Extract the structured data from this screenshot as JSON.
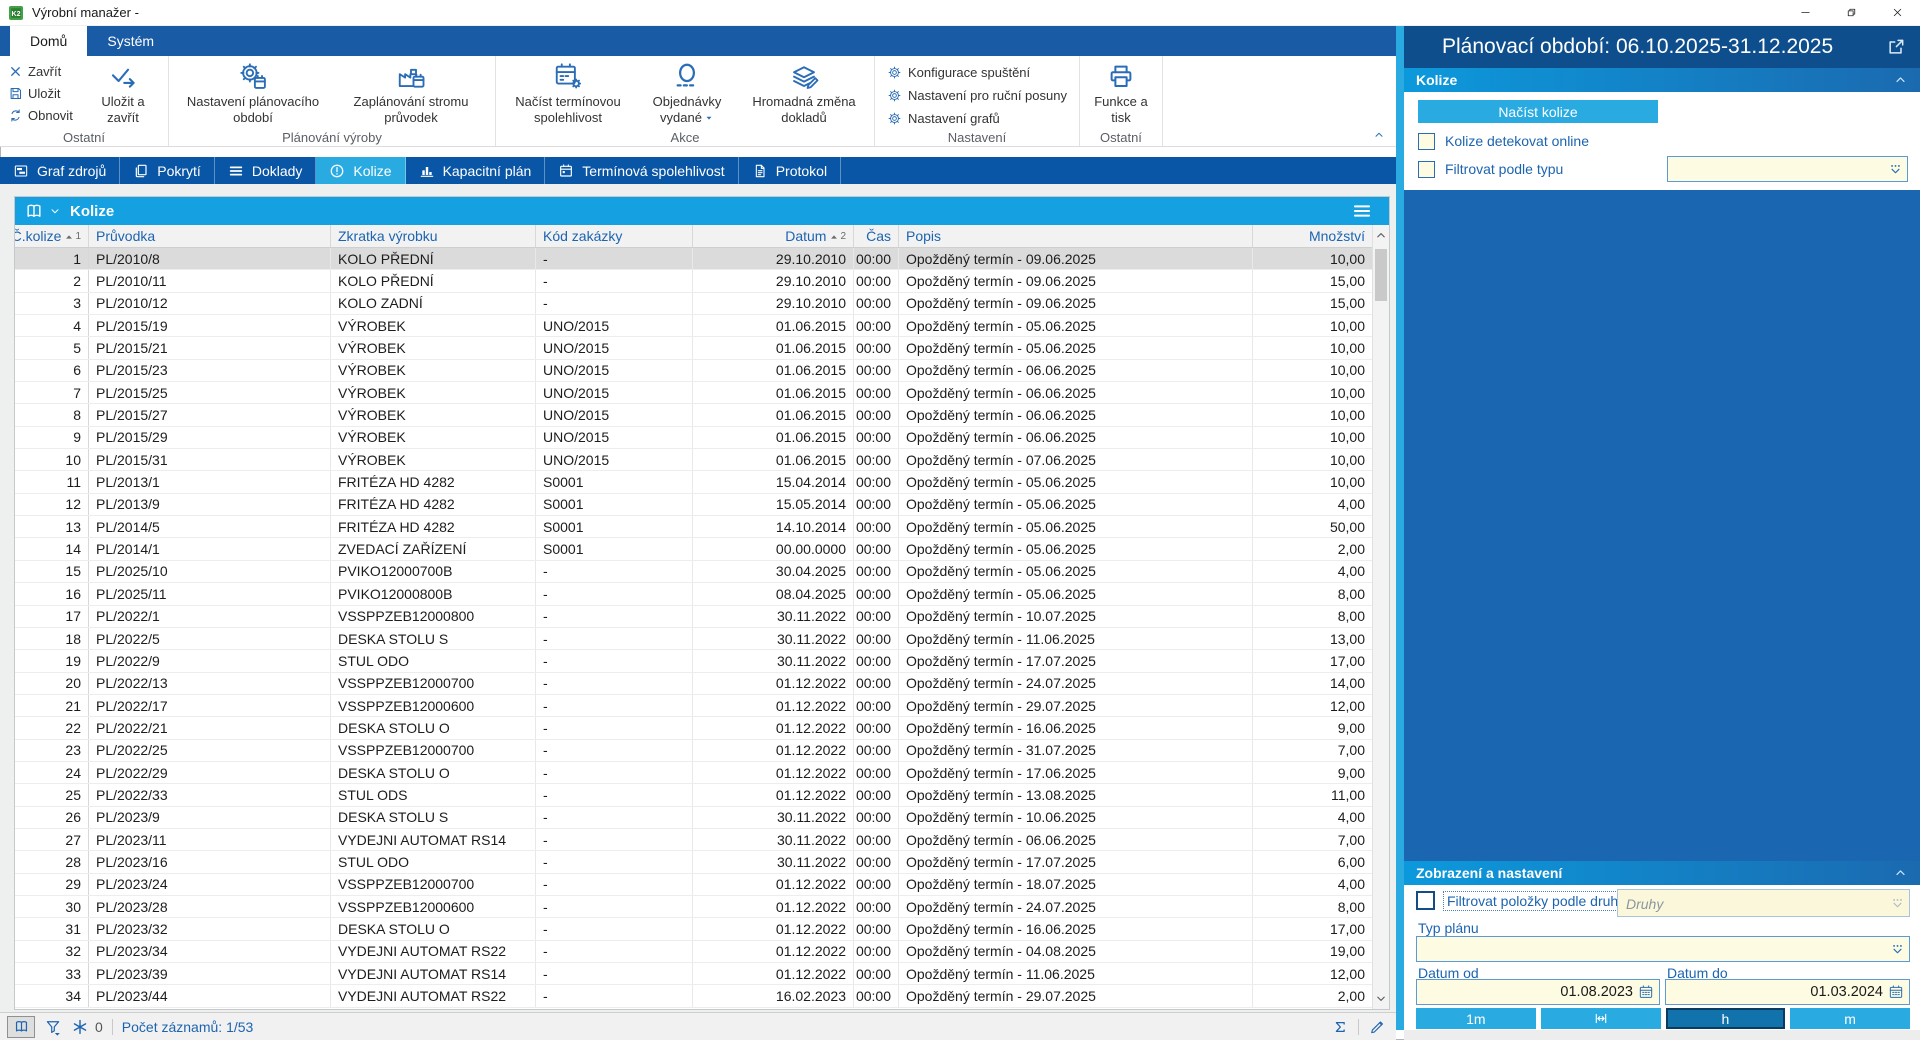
{
  "window": {
    "title": "Výrobní manažer -"
  },
  "ribbon": {
    "tabs": [
      {
        "label": "Domů",
        "active": true
      },
      {
        "label": "Systém",
        "active": false
      }
    ],
    "groups": [
      {
        "label": "Ostatní",
        "small_buttons": [
          {
            "icon": "close-x-icon",
            "label": "Zavřít"
          },
          {
            "icon": "save-icon",
            "label": "Uložit"
          },
          {
            "icon": "refresh-icon",
            "label": "Obnovit"
          }
        ],
        "big_buttons": [
          {
            "icon": "save-close-icon",
            "label": "Uložit a zavřít"
          }
        ]
      },
      {
        "label": "Plánování výroby",
        "big_buttons": [
          {
            "icon": "gear-calendar-icon",
            "label": "Nastavení plánovacího období"
          },
          {
            "icon": "factory-calendar-icon",
            "label": "Zaplánování stromu průvodek"
          }
        ]
      },
      {
        "label": "Akce",
        "big_buttons": [
          {
            "icon": "calendar-gear-icon",
            "label": "Načíst termínovou spolehlivost"
          },
          {
            "icon": "orders-icon",
            "label": "Objednávky vydané",
            "dropdown": true
          },
          {
            "icon": "documents-edit-icon",
            "label": "Hromadná změna dokladů"
          }
        ]
      },
      {
        "label": "Nastavení",
        "menu_items": [
          {
            "icon": "gear-icon",
            "label": "Konfigurace spuštění"
          },
          {
            "icon": "gear-icon",
            "label": "Nastavení pro ruční posuny"
          },
          {
            "icon": "gear-icon",
            "label": "Nastavení grafů"
          }
        ]
      },
      {
        "label": "Ostatní",
        "big_buttons": [
          {
            "icon": "printer-icon",
            "label": "Funkce a tisk"
          }
        ]
      }
    ]
  },
  "view_tabs": [
    {
      "label": "Graf zdrojů",
      "icon": "graf-zdroju-icon",
      "active": false
    },
    {
      "label": "Pokrytí",
      "icon": "pokryti-icon",
      "active": false
    },
    {
      "label": "Doklady",
      "icon": "doklady-icon",
      "active": false
    },
    {
      "label": "Kolize",
      "icon": "kolize-icon",
      "active": true
    },
    {
      "label": "Kapacitní plán",
      "icon": "kapacitni-plan-icon",
      "active": false
    },
    {
      "label": "Termínová spolehlivost",
      "icon": "terminova-icon",
      "active": false
    },
    {
      "label": "Protokol",
      "icon": "protokol-icon",
      "active": false
    }
  ],
  "grid": {
    "title": "Kolize",
    "columns": [
      {
        "label": "Č.kolize",
        "align": "right",
        "sort": "1"
      },
      {
        "label": "Průvodka",
        "align": "left"
      },
      {
        "label": "Zkratka výrobku",
        "align": "left"
      },
      {
        "label": "Kód zakázky",
        "align": "left"
      },
      {
        "label": "Datum",
        "align": "right",
        "sort": "2"
      },
      {
        "label": "Čas",
        "align": "right"
      },
      {
        "label": "Popis",
        "align": "left"
      },
      {
        "label": "Množství",
        "align": "right"
      }
    ],
    "selected_row_index": 0,
    "rows": [
      [
        "1",
        "PL/2010/8",
        "KOLO PŘEDNÍ",
        "-",
        "29.10.2010",
        "00:00",
        "Opožděný termín - 09.06.2025",
        "10,00"
      ],
      [
        "2",
        "PL/2010/11",
        "KOLO PŘEDNÍ",
        "-",
        "29.10.2010",
        "00:00",
        "Opožděný termín - 09.06.2025",
        "15,00"
      ],
      [
        "3",
        "PL/2010/12",
        "KOLO ZADNÍ",
        "-",
        "29.10.2010",
        "00:00",
        "Opožděný termín - 09.06.2025",
        "15,00"
      ],
      [
        "4",
        "PL/2015/19",
        "VÝROBEK",
        "UNO/2015",
        "01.06.2015",
        "00:00",
        "Opožděný termín - 05.06.2025",
        "10,00"
      ],
      [
        "5",
        "PL/2015/21",
        "VÝROBEK",
        "UNO/2015",
        "01.06.2015",
        "00:00",
        "Opožděný termín - 05.06.2025",
        "10,00"
      ],
      [
        "6",
        "PL/2015/23",
        "VÝROBEK",
        "UNO/2015",
        "01.06.2015",
        "00:00",
        "Opožděný termín - 06.06.2025",
        "10,00"
      ],
      [
        "7",
        "PL/2015/25",
        "VÝROBEK",
        "UNO/2015",
        "01.06.2015",
        "00:00",
        "Opožděný termín - 06.06.2025",
        "10,00"
      ],
      [
        "8",
        "PL/2015/27",
        "VÝROBEK",
        "UNO/2015",
        "01.06.2015",
        "00:00",
        "Opožděný termín - 06.06.2025",
        "10,00"
      ],
      [
        "9",
        "PL/2015/29",
        "VÝROBEK",
        "UNO/2015",
        "01.06.2015",
        "00:00",
        "Opožděný termín - 06.06.2025",
        "10,00"
      ],
      [
        "10",
        "PL/2015/31",
        "VÝROBEK",
        "UNO/2015",
        "01.06.2015",
        "00:00",
        "Opožděný termín - 07.06.2025",
        "10,00"
      ],
      [
        "11",
        "PL/2013/1",
        "FRITÉZA HD 4282",
        "S0001",
        "15.04.2014",
        "00:00",
        "Opožděný termín - 05.06.2025",
        "10,00"
      ],
      [
        "12",
        "PL/2013/9",
        "FRITÉZA HD 4282",
        "S0001",
        "15.05.2014",
        "00:00",
        "Opožděný termín - 05.06.2025",
        "4,00"
      ],
      [
        "13",
        "PL/2014/5",
        "FRITÉZA HD 4282",
        "S0001",
        "14.10.2014",
        "00:00",
        "Opožděný termín - 05.06.2025",
        "50,00"
      ],
      [
        "14",
        "PL/2014/1",
        "ZVEDACÍ ZAŘÍZENÍ",
        "S0001",
        "00.00.0000",
        "00:00",
        "Opožděný termín - 05.06.2025",
        "2,00"
      ],
      [
        "15",
        "PL/2025/10",
        "PVIKO12000700B",
        "-",
        "30.04.2025",
        "00:00",
        "Opožděný termín - 05.06.2025",
        "4,00"
      ],
      [
        "16",
        "PL/2025/11",
        "PVIKO12000800B",
        "-",
        "08.04.2025",
        "00:00",
        "Opožděný termín - 05.06.2025",
        "8,00"
      ],
      [
        "17",
        "PL/2022/1",
        "VSSPPZEB12000800",
        "-",
        "30.11.2022",
        "00:00",
        "Opožděný termín - 10.07.2025",
        "8,00"
      ],
      [
        "18",
        "PL/2022/5",
        "DESKA STOLU S",
        "-",
        "30.11.2022",
        "00:00",
        "Opožděný termín - 11.06.2025",
        "13,00"
      ],
      [
        "19",
        "PL/2022/9",
        "STUL ODO",
        "-",
        "30.11.2022",
        "00:00",
        "Opožděný termín - 17.07.2025",
        "17,00"
      ],
      [
        "20",
        "PL/2022/13",
        "VSSPPZEB12000700",
        "-",
        "01.12.2022",
        "00:00",
        "Opožděný termín - 24.07.2025",
        "14,00"
      ],
      [
        "21",
        "PL/2022/17",
        "VSSPPZEB12000600",
        "-",
        "01.12.2022",
        "00:00",
        "Opožděný termín - 29.07.2025",
        "12,00"
      ],
      [
        "22",
        "PL/2022/21",
        "DESKA STOLU O",
        "-",
        "01.12.2022",
        "00:00",
        "Opožděný termín - 16.06.2025",
        "9,00"
      ],
      [
        "23",
        "PL/2022/25",
        "VSSPPZEB12000700",
        "-",
        "01.12.2022",
        "00:00",
        "Opožděný termín - 31.07.2025",
        "7,00"
      ],
      [
        "24",
        "PL/2022/29",
        "DESKA STOLU O",
        "-",
        "01.12.2022",
        "00:00",
        "Opožděný termín - 17.06.2025",
        "9,00"
      ],
      [
        "25",
        "PL/2022/33",
        "STUL ODS",
        "-",
        "01.12.2022",
        "00:00",
        "Opožděný termín - 13.08.2025",
        "11,00"
      ],
      [
        "26",
        "PL/2023/9",
        "DESKA STOLU S",
        "-",
        "30.11.2022",
        "00:00",
        "Opožděný termín - 10.06.2025",
        "4,00"
      ],
      [
        "27",
        "PL/2023/11",
        "VYDEJNI AUTOMAT RS14",
        "-",
        "30.11.2022",
        "00:00",
        "Opožděný termín - 06.06.2025",
        "7,00"
      ],
      [
        "28",
        "PL/2023/16",
        "STUL ODO",
        "-",
        "30.11.2022",
        "00:00",
        "Opožděný termín - 17.07.2025",
        "6,00"
      ],
      [
        "29",
        "PL/2023/24",
        "VSSPPZEB12000700",
        "-",
        "01.12.2022",
        "00:00",
        "Opožděný termín - 18.07.2025",
        "4,00"
      ],
      [
        "30",
        "PL/2023/28",
        "VSSPPZEB12000600",
        "-",
        "01.12.2022",
        "00:00",
        "Opožděný termín - 24.07.2025",
        "8,00"
      ],
      [
        "31",
        "PL/2023/32",
        "DESKA STOLU O",
        "-",
        "01.12.2022",
        "00:00",
        "Opožděný termín - 16.06.2025",
        "17,00"
      ],
      [
        "32",
        "PL/2023/34",
        "VYDEJNI AUTOMAT RS22",
        "-",
        "01.12.2022",
        "00:00",
        "Opožděný termín - 04.08.2025",
        "19,00"
      ],
      [
        "33",
        "PL/2023/39",
        "VYDEJNI AUTOMAT RS14",
        "-",
        "01.12.2022",
        "00:00",
        "Opožděný termín - 11.06.2025",
        "12,00"
      ],
      [
        "34",
        "PL/2023/44",
        "VYDEJNI AUTOMAT RS22",
        "-",
        "16.02.2023",
        "00:00",
        "Opožděný termín - 29.07.2025",
        "2,00"
      ]
    ]
  },
  "statusbar": {
    "counter": "0",
    "records_label": "Počet záznamů: 1/53"
  },
  "panel": {
    "header": "Plánovací období: 06.10.2025-31.12.2025",
    "kolize": {
      "title": "Kolize",
      "load_button": "Načíst kolize",
      "checkbox_online": "Kolize detekovat online",
      "checkbox_filter": "Filtrovat podle typu",
      "type_combo_value": ""
    },
    "zobrazeni": {
      "title": "Zobrazení a nastavení",
      "filter_checkbox_label": "Filtrovat položky podle druhů:",
      "druhy_placeholder": "Druhy",
      "typ_planu_label": "Typ plánu",
      "typ_planu_value": "",
      "datum_od_label": "Datum od",
      "datum_od_value": "01.08.2023",
      "datum_do_label": "Datum do",
      "datum_do_value": "01.03.2024",
      "buttons": [
        {
          "label": "1m"
        },
        {
          "label": "",
          "icon": "range-icon"
        },
        {
          "label": "h",
          "active": true
        },
        {
          "label": "m"
        }
      ]
    }
  },
  "colors": {
    "accent_blue": "#1c64b0",
    "cyan": "#29abe2",
    "ribbon_tab_blue": "#1a5ba6",
    "view_strip_blue": "#0a56a6",
    "grid_title_cyan": "#14a0e1",
    "panel_header_blue": "#0e4e8c",
    "panel_body_blue": "#1b66b0",
    "input_yellow": "#fdfce3"
  }
}
